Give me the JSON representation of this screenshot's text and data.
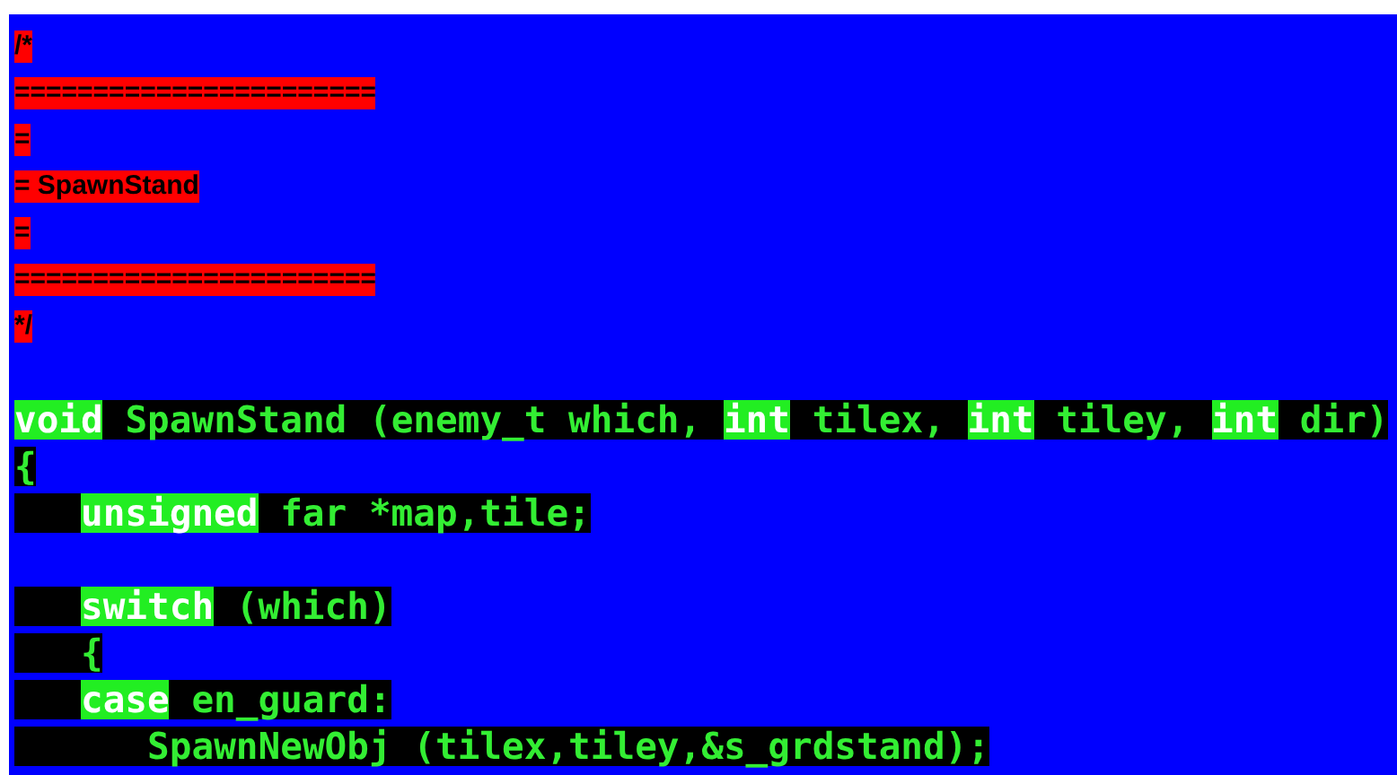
{
  "lines": [
    {
      "kind": "comment",
      "text": "/*"
    },
    {
      "kind": "comment",
      "text": "======================="
    },
    {
      "kind": "comment",
      "text": "="
    },
    {
      "kind": "comment",
      "text": "= SpawnStand"
    },
    {
      "kind": "comment",
      "text": "="
    },
    {
      "kind": "comment",
      "text": "======================="
    },
    {
      "kind": "comment",
      "text": "*/"
    },
    {
      "kind": "blank"
    },
    {
      "kind": "code",
      "segments": [
        {
          "kind": "keyword",
          "text": "void"
        },
        {
          "kind": "plain",
          "text": " SpawnStand (enemy_t which, "
        },
        {
          "kind": "keyword",
          "text": "int"
        },
        {
          "kind": "plain",
          "text": " tilex, "
        },
        {
          "kind": "keyword",
          "text": "int"
        },
        {
          "kind": "plain",
          "text": " tiley, "
        },
        {
          "kind": "keyword",
          "text": "int"
        },
        {
          "kind": "plain",
          "text": " dir)"
        }
      ]
    },
    {
      "kind": "code",
      "segments": [
        {
          "kind": "plain",
          "text": "{"
        }
      ]
    },
    {
      "kind": "code",
      "segments": [
        {
          "kind": "indent"
        },
        {
          "kind": "keyword",
          "text": "unsigned"
        },
        {
          "kind": "plain",
          "text": " far *map,tile;"
        }
      ]
    },
    {
      "kind": "blank"
    },
    {
      "kind": "code",
      "segments": [
        {
          "kind": "indent"
        },
        {
          "kind": "keyword",
          "text": "switch"
        },
        {
          "kind": "plain",
          "text": " (which)"
        }
      ]
    },
    {
      "kind": "code",
      "segments": [
        {
          "kind": "plain",
          "text": "   {"
        }
      ]
    },
    {
      "kind": "code",
      "segments": [
        {
          "kind": "indent"
        },
        {
          "kind": "keyword",
          "text": "case"
        },
        {
          "kind": "plain",
          "text": " en_guard:"
        }
      ]
    },
    {
      "kind": "code",
      "segments": [
        {
          "kind": "plain",
          "text": "      SpawnNewObj (tilex,tiley,&s_grdstand);"
        }
      ]
    }
  ]
}
